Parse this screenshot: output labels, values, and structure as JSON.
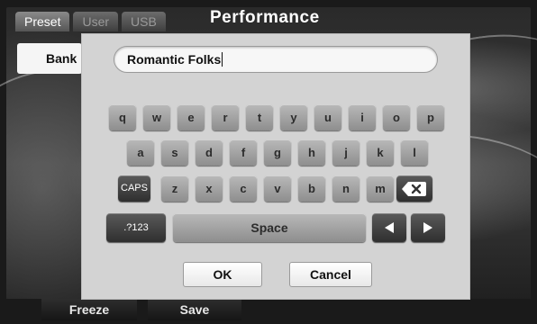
{
  "header": {
    "tabs": [
      {
        "label": "Preset",
        "active": true
      },
      {
        "label": "User",
        "active": false
      },
      {
        "label": "USB",
        "active": false
      }
    ],
    "title": "Performance"
  },
  "side": {
    "bank_label": "Bank"
  },
  "dialog": {
    "name_value": "Romantic Folks",
    "rows": [
      [
        "q",
        "w",
        "e",
        "r",
        "t",
        "y",
        "u",
        "i",
        "o",
        "p"
      ],
      [
        "a",
        "s",
        "d",
        "f",
        "g",
        "h",
        "j",
        "k",
        "l"
      ],
      [
        "z",
        "x",
        "c",
        "v",
        "b",
        "n",
        "m"
      ]
    ],
    "caps_label": "CAPS",
    "symbols_label": ".?123",
    "space_label": "Space",
    "backspace_icon": "backspace-icon",
    "left_icon": "arrow-left-icon",
    "right_icon": "arrow-right-icon",
    "ok_label": "OK",
    "cancel_label": "Cancel"
  },
  "footer": {
    "freeze_label": "Freeze",
    "save_label": "Save"
  }
}
